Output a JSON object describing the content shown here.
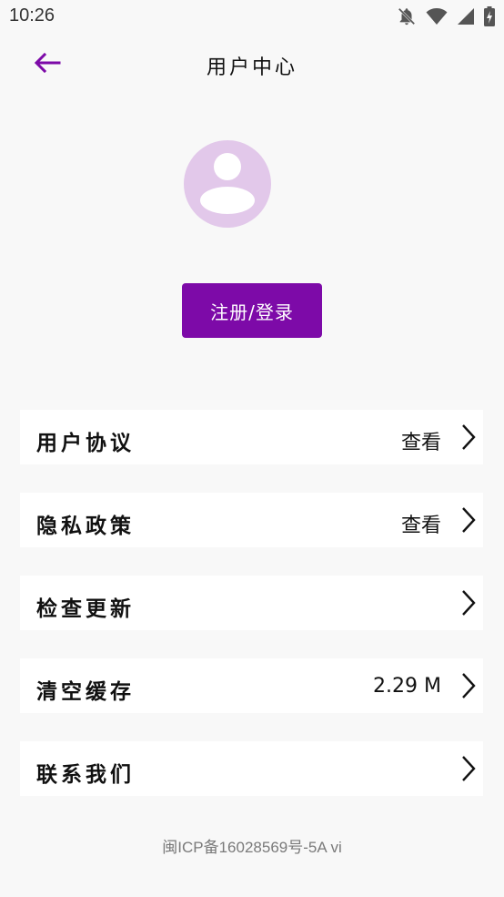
{
  "status_bar": {
    "time": "10:26",
    "icons": [
      "notifications-off-icon",
      "wifi-icon",
      "cellular-signal-icon",
      "battery-charging-icon"
    ]
  },
  "app_bar": {
    "title": "用户中心",
    "back_icon": "back-arrow-icon"
  },
  "profile": {
    "avatar_icon": "default-avatar-icon",
    "login_button_label": "注册/登录"
  },
  "menu": {
    "items": [
      {
        "label": "用户协议",
        "value": "查看"
      },
      {
        "label": "隐私政策",
        "value": "查看"
      },
      {
        "label": "检查更新",
        "value": ""
      },
      {
        "label": "清空缓存",
        "value": "2.29 M"
      },
      {
        "label": "联系我们",
        "value": ""
      }
    ]
  },
  "footer": {
    "icp_text": "闽ICP备16028569号-5A vi"
  },
  "colors": {
    "accent": "#7d0aa8",
    "avatar_bg": "#e2c8ea",
    "background": "#f8f8f8"
  }
}
